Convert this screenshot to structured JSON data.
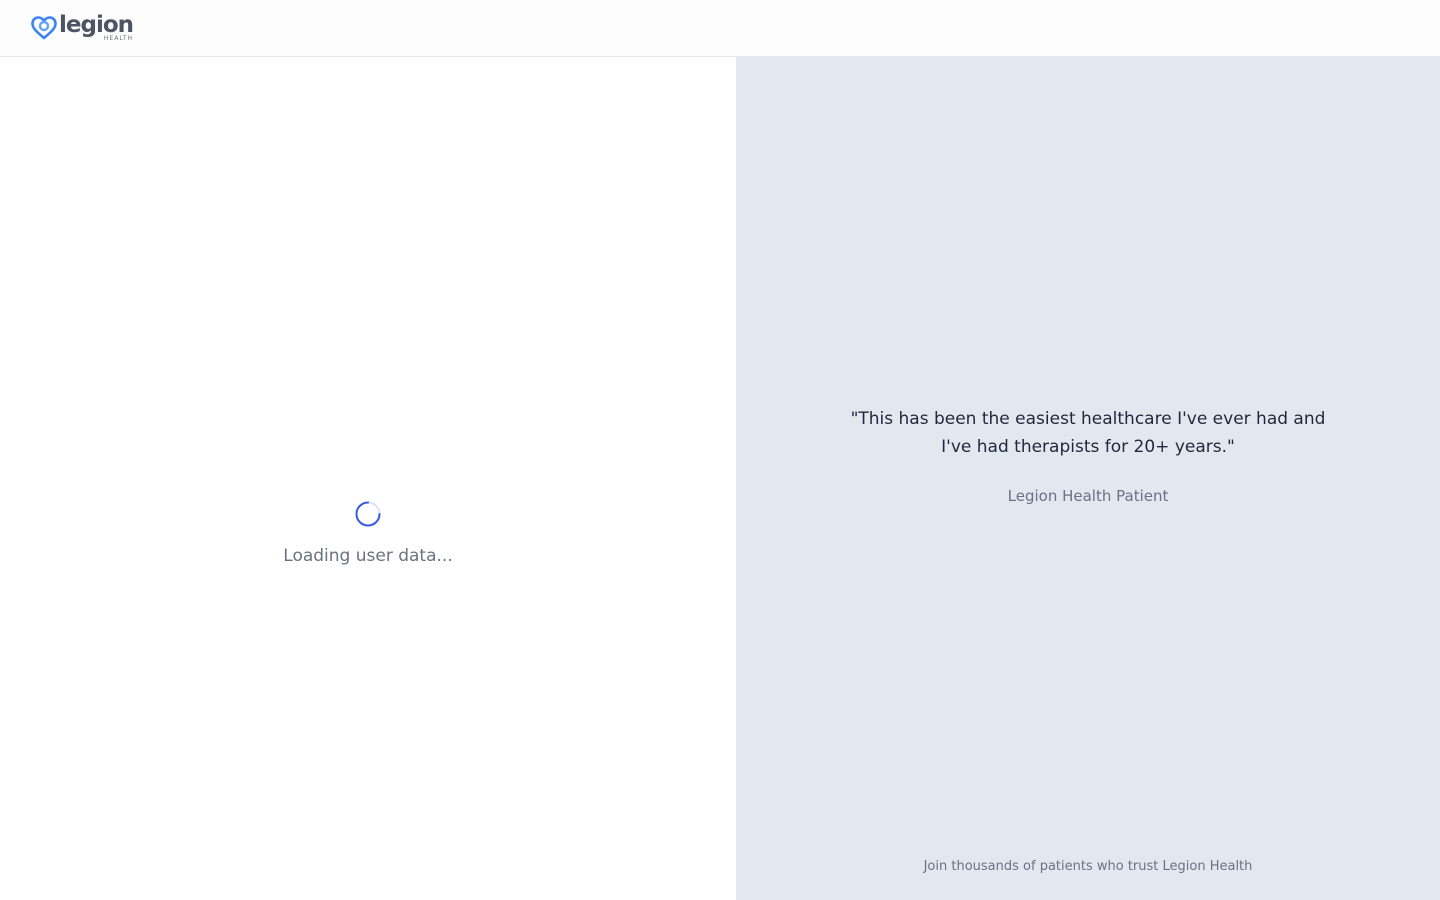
{
  "header": {
    "logo": {
      "word": "legion",
      "subword": "HEALTH",
      "icon": "heart-logo-icon"
    }
  },
  "left": {
    "loading_text": "Loading user data...",
    "spinner_icon": "spinner-icon"
  },
  "right": {
    "quote": "\"This has been the easiest healthcare I've ever had and I've had therapists for 20+ years.\"",
    "attribution": "Legion Health Patient",
    "footer": "Join thousands of patients who trust Legion Health"
  },
  "colors": {
    "brand_blue": "#3b82f6",
    "panel_bg": "#e2e8f0",
    "spinner": "#3b5bdb"
  }
}
